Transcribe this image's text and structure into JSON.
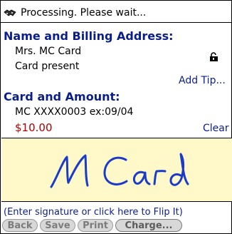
{
  "status": {
    "icon": "handshake-icon",
    "text": "Processing. Please wait..."
  },
  "billing": {
    "title": "Name and Billing Address:",
    "name": "Mrs. MC Card",
    "card_status": "Card present",
    "lock_icon": "lock-open-icon",
    "add_tip_label": "Add Tip..."
  },
  "card": {
    "title": "Card and Amount:",
    "details": "MC XXXX0003 ex:09/04",
    "amount": "$10.00",
    "clear_label": "Clear"
  },
  "signature": {
    "signed_text": "M Card",
    "hint": "(Enter signature or click here to Flip It)",
    "pad_color": "#fff8c8",
    "ink_color": "#1a3cc8"
  },
  "buttons": {
    "back": "Back",
    "save": "Save",
    "print": "Print",
    "charge": "Charge..."
  },
  "colors": {
    "heading": "#0a1e8c",
    "amount": "#b00000"
  }
}
